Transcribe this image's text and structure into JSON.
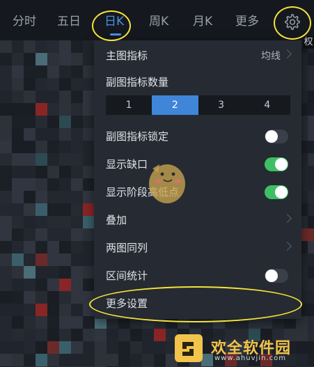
{
  "tabs": [
    {
      "label": "分时"
    },
    {
      "label": "五日"
    },
    {
      "label": "日K"
    },
    {
      "label": "周K"
    },
    {
      "label": "月K"
    },
    {
      "label": "更多"
    }
  ],
  "active_tab": "日K",
  "side_marker": "权",
  "menu": {
    "main_indicator": {
      "label": "主图指标",
      "value": "均线"
    },
    "sub_count": {
      "label": "副图指标数量",
      "options": [
        "1",
        "2",
        "3",
        "4"
      ],
      "selected": "2"
    },
    "sub_lock": {
      "label": "副图指标锁定",
      "on": false
    },
    "show_gap": {
      "label": "显示缺口",
      "on": true
    },
    "show_highlow": {
      "label": "显示阶段高低点",
      "on": true
    },
    "overlay": {
      "label": "叠加"
    },
    "two_col": {
      "label": "两图同列"
    },
    "interval_stats": {
      "label": "区间统计",
      "on": false
    },
    "more_settings": {
      "label": "更多设置"
    }
  },
  "watermark": {
    "text": "欢全软件园",
    "url": "www.ahuvjin.com"
  },
  "colors": {
    "accent": "#3f86d9",
    "toggle_on": "#3fbf64",
    "annotation": "#f4e43a",
    "menu_bg": "#262a32"
  }
}
